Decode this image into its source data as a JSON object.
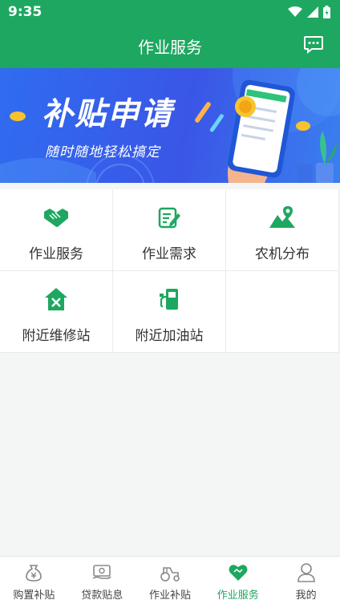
{
  "status": {
    "time": "9:35"
  },
  "header": {
    "title": "作业服务"
  },
  "banner": {
    "title": "补贴申请",
    "subtitle": "随时随地轻松搞定"
  },
  "grid": [
    {
      "label": "作业服务",
      "icon": "handshake-icon"
    },
    {
      "label": "作业需求",
      "icon": "edit-document-icon"
    },
    {
      "label": "农机分布",
      "icon": "map-location-icon"
    },
    {
      "label": "附近维修站",
      "icon": "repair-house-icon"
    },
    {
      "label": "附近加油站",
      "icon": "gas-station-icon"
    }
  ],
  "tabs": [
    {
      "label": "购置补贴",
      "icon": "money-bag-icon",
      "active": false
    },
    {
      "label": "贷款贴息",
      "icon": "cash-icon",
      "active": false
    },
    {
      "label": "作业补贴",
      "icon": "tractor-icon",
      "active": false
    },
    {
      "label": "作业服务",
      "icon": "heart-icon",
      "active": true
    },
    {
      "label": "我的",
      "icon": "user-icon",
      "active": false
    }
  ],
  "colors": {
    "primary": "#1ea760",
    "text": "#333333",
    "banner": "#3a56e6"
  }
}
